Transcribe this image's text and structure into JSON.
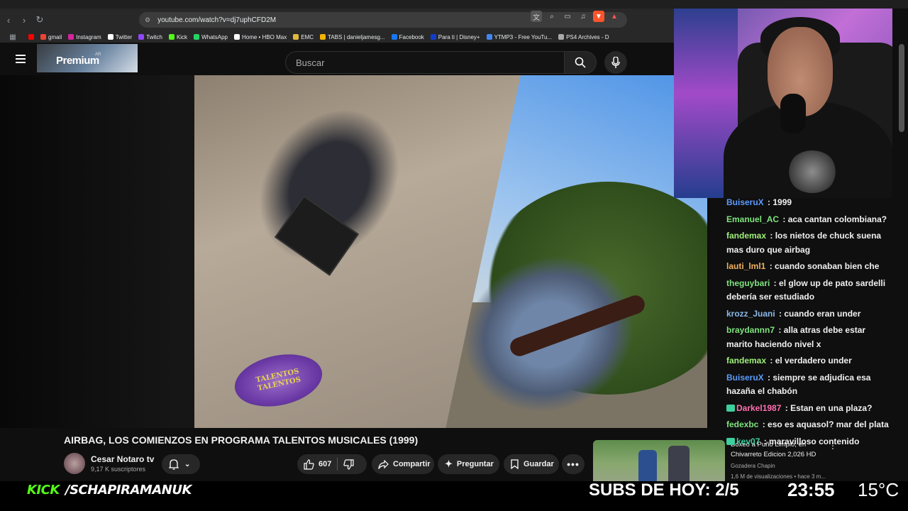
{
  "browser": {
    "url": "youtube.com/watch?v=dj7uphCFD2M",
    "bookmarks": [
      {
        "label": "gmail",
        "color": "#ea4335"
      },
      {
        "label": "Instagram",
        "color": "#d6249f"
      },
      {
        "label": "Twitter",
        "color": "#ffffff"
      },
      {
        "label": "Twitch",
        "color": "#9146ff"
      },
      {
        "label": "Kick",
        "color": "#53fc18"
      },
      {
        "label": "WhatsApp",
        "color": "#25d366"
      },
      {
        "label": "Home • HBO Max",
        "color": "#ffffff"
      },
      {
        "label": "EMC",
        "color": "#e2b93b"
      },
      {
        "label": "TABS | danieljamesg...",
        "color": "#f4b400"
      },
      {
        "label": "Facebook",
        "color": "#1877f2"
      },
      {
        "label": "Para ti | Disney+",
        "color": "#113ccf"
      },
      {
        "label": "YTMP3 - Free YouTu...",
        "color": "#4285f4"
      },
      {
        "label": "PS4 Archives - D",
        "color": "#aaaaaa"
      }
    ]
  },
  "youtube": {
    "premium_label": "Premium",
    "country_tag": "AR",
    "search_placeholder": "Buscar"
  },
  "video": {
    "overlay_logo": "TALENTOS TALENTOS",
    "title": "AIRBAG, LOS COMIENZOS EN PROGRAMA TALENTOS MUSICALES (1999)",
    "channel": "Cesar Notaro tv",
    "subscribers": "9,17 K suscriptores",
    "likes": "607",
    "share_label": "Compartir",
    "ask_label": "Preguntar",
    "save_label": "Guardar"
  },
  "recommended": {
    "title": "Boxeo a Puño Limpio, en Chivarreto Edicion 2,026 HD",
    "channel": "Gozadera Chapin",
    "meta": "1,6 M de visualizaciones • hace 3 m..."
  },
  "chat": [
    {
      "user": "BuiseruX",
      "color": "#5b9bff",
      "text": "1999"
    },
    {
      "user": "Emanuel_AC",
      "color": "#7ee37e",
      "text": "aca cantan colombiana?"
    },
    {
      "user": "fandemax",
      "color": "#9ff07a",
      "text": "los nietos de chuck suena mas duro que airbag"
    },
    {
      "user": "lauti_lml1",
      "color": "#f0b060",
      "text": "cuando sonaban bien che"
    },
    {
      "user": "theguybari",
      "color": "#7ee37e",
      "text": "el glow up de pato sardelli debería ser estudiado"
    },
    {
      "user": "krozz_Juani",
      "color": "#8ab8e8",
      "text": "cuando eran under"
    },
    {
      "user": "braydannn7",
      "color": "#7ee37e",
      "text": "alla atras debe estar marito haciendo nivel x"
    },
    {
      "user": "fandemax",
      "color": "#9ff07a",
      "text": "el verdadero under"
    },
    {
      "user": "BuiseruX",
      "color": "#5b9bff",
      "text": "siempre se adjudica esa hazaña el chabón"
    },
    {
      "user": "Darkel1987",
      "color": "#ff6fb0",
      "text": "Estan en una plaza?"
    },
    {
      "user": "fedexbc",
      "color": "#7ee37e",
      "text": "eso es aquasol? mar del plata"
    },
    {
      "user": "kev07",
      "color": "#3ecfa0",
      "text": "maravilloso contenido"
    }
  ],
  "overlay": {
    "kick_label": "KICK",
    "handle": "/SCHAPIRAMANUK",
    "subs_today": "SUBS DE HOY: 2/5",
    "time": "23:55",
    "temperature": "15°C"
  }
}
